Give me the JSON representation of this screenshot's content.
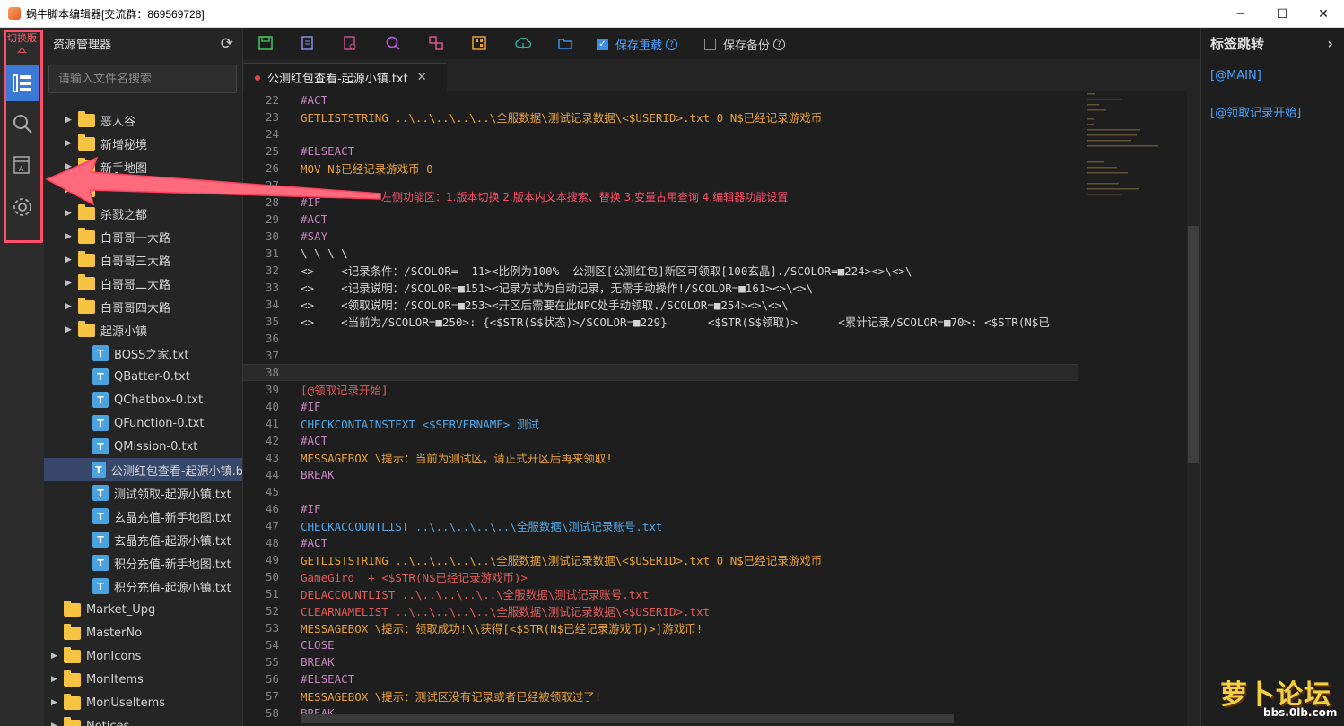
{
  "window": {
    "title": "蜗牛脚本编辑器[交流群：869569728]",
    "minimize": "─",
    "maximize": "☐",
    "close": "✕"
  },
  "activity": {
    "switch_version": "切换版本",
    "icons": [
      "explorer-icon",
      "search-icon",
      "variable-icon",
      "settings-icon"
    ]
  },
  "sidebar": {
    "title": "资源管理器",
    "search_placeholder": "请输入文件名搜索",
    "items": [
      {
        "type": "folder",
        "label": "恶人谷",
        "indent": 1
      },
      {
        "type": "folder",
        "label": "新增秘境",
        "indent": 1
      },
      {
        "type": "folder",
        "label": "新手地图",
        "indent": 1
      },
      {
        "type": "folder",
        "label": "",
        "indent": 1
      },
      {
        "type": "folder",
        "label": "杀戮之都",
        "indent": 1
      },
      {
        "type": "folder",
        "label": "白哥哥一大路",
        "indent": 1
      },
      {
        "type": "folder",
        "label": "白哥哥三大路",
        "indent": 1
      },
      {
        "type": "folder",
        "label": "白哥哥二大路",
        "indent": 1
      },
      {
        "type": "folder",
        "label": "白哥哥四大路",
        "indent": 1
      },
      {
        "type": "folder",
        "label": "起源小镇",
        "indent": 1
      },
      {
        "type": "file",
        "label": "BOSS之家.txt",
        "indent": 2
      },
      {
        "type": "file",
        "label": "QBatter-0.txt",
        "indent": 2
      },
      {
        "type": "file",
        "label": "QChatbox-0.txt",
        "indent": 2
      },
      {
        "type": "file",
        "label": "QFunction-0.txt",
        "indent": 2
      },
      {
        "type": "file",
        "label": "QMission-0.txt",
        "indent": 2
      },
      {
        "type": "file",
        "label": "公测红包查看-起源小镇.b",
        "indent": 2,
        "selected": true
      },
      {
        "type": "file",
        "label": "测试领取-起源小镇.txt",
        "indent": 2
      },
      {
        "type": "file",
        "label": "玄晶充值-新手地图.txt",
        "indent": 2
      },
      {
        "type": "file",
        "label": "玄晶充值-起源小镇.txt",
        "indent": 2
      },
      {
        "type": "file",
        "label": "积分充值-新手地图.txt",
        "indent": 2
      },
      {
        "type": "file",
        "label": "积分充值-起源小镇.txt",
        "indent": 2
      },
      {
        "type": "folder",
        "label": "Market_Upg",
        "indent": 0,
        "noarrow": true
      },
      {
        "type": "folder",
        "label": "MasterNo",
        "indent": 0,
        "noarrow": true
      },
      {
        "type": "folder",
        "label": "MonIcons",
        "indent": 0
      },
      {
        "type": "folder",
        "label": "MonItems",
        "indent": 0
      },
      {
        "type": "folder",
        "label": "MonUseItems",
        "indent": 0
      },
      {
        "type": "folder",
        "label": "Notices",
        "indent": 0
      }
    ]
  },
  "toolbar": {
    "save_reload": "保存重载",
    "save_backup": "保存备份"
  },
  "tab": {
    "label": "公测红包查看-起源小镇.txt",
    "close": "✕"
  },
  "editor": {
    "lines": [
      {
        "n": "22",
        "t": "#ACT",
        "c": "#c586c0"
      },
      {
        "n": "23",
        "t": "GETLISTSTRING ..\\..\\..\\..\\..\\全服数据\\测试记录数据\\<$USERID>.txt 0 N$已经记录游戏币",
        "c": "#e8a23a"
      },
      {
        "n": "24",
        "t": "",
        "c": "#ccc"
      },
      {
        "n": "25",
        "t": "#ELSEACT",
        "c": "#c586c0"
      },
      {
        "n": "26",
        "t": "MOV N$已经记录游戏币 0",
        "c": "#e8a23a"
      },
      {
        "n": "27",
        "t": "",
        "c": "#ccc"
      },
      {
        "n": "28",
        "t": "#IF",
        "c": "#c586c0"
      },
      {
        "n": "29",
        "t": "#ACT",
        "c": "#c586c0"
      },
      {
        "n": "30",
        "t": "#SAY",
        "c": "#c586c0"
      },
      {
        "n": "31",
        "t": "\\ \\ \\ \\",
        "c": "#d4d4d4"
      },
      {
        "n": "32",
        "t": "<>    <记录条件：/SCOLOR=  11><比例为100%  公测区[公测红包]新区可领取[100玄晶]./SCOLOR=■224><>\\<>\\",
        "c": "#d4d4d4"
      },
      {
        "n": "33",
        "t": "<>    <记录说明：/SCOLOR=■151><记录方式为自动记录，无需手动操作!/SCOLOR=■161><>\\<>\\",
        "c": "#d4d4d4"
      },
      {
        "n": "34",
        "t": "<>    <领取说明：/SCOLOR=■253><开区后需要在此NPC处手动领取./SCOLOR=■254><>\\<>\\",
        "c": "#d4d4d4"
      },
      {
        "n": "35",
        "t": "<>    <当前为/SCOLOR=■250>: {<$STR(S$状态)>/SCOLOR=■229}      <$STR(S$领取)>      <累计记录/SCOLOR=■70>: <$STR(N$已",
        "c": "#d4d4d4"
      },
      {
        "n": "36",
        "t": "",
        "c": "#ccc"
      },
      {
        "n": "37",
        "t": "",
        "c": "#ccc"
      },
      {
        "n": "38",
        "t": "",
        "c": "#ccc"
      },
      {
        "n": "39",
        "t": "[@领取记录开始]",
        "c": "#e55b5b"
      },
      {
        "n": "40",
        "t": "#IF",
        "c": "#c586c0"
      },
      {
        "n": "41",
        "t": "CHECKCONTAINSTEXT <$SERVERNAME> 测试",
        "c": "#4fa8e8"
      },
      {
        "n": "42",
        "t": "#ACT",
        "c": "#c586c0"
      },
      {
        "n": "43",
        "t": "MESSAGEBOX \\提示：当前为测试区，请正式开区后再来领取!",
        "c": "#e8a23a"
      },
      {
        "n": "44",
        "t": "BREAK",
        "c": "#c586c0"
      },
      {
        "n": "45",
        "t": "",
        "c": "#ccc"
      },
      {
        "n": "46",
        "t": "#IF",
        "c": "#c586c0"
      },
      {
        "n": "47",
        "t": "CHECKACCOUNTLIST ..\\..\\..\\..\\..\\全服数据\\测试记录账号.txt",
        "c": "#4fa8e8"
      },
      {
        "n": "48",
        "t": "#ACT",
        "c": "#c586c0"
      },
      {
        "n": "49",
        "t": "GETLISTSTRING ..\\..\\..\\..\\..\\全服数据\\测试记录数据\\<$USERID>.txt 0 N$已经记录游戏币",
        "c": "#e8a23a"
      },
      {
        "n": "50",
        "t": "GameGird  + <$STR(N$已经记录游戏币)>",
        "c": "#e55b5b"
      },
      {
        "n": "51",
        "t": "DELACCOUNTLIST ..\\..\\..\\..\\..\\全服数据\\测试记录账号.txt",
        "c": "#e55b5b"
      },
      {
        "n": "52",
        "t": "CLEARNAMELIST ..\\..\\..\\..\\..\\全服数据\\测试记录数据\\<$USERID>.txt",
        "c": "#e55b5b"
      },
      {
        "n": "53",
        "t": "MESSAGEBOX \\提示：领取成功!\\\\获得[<$STR(N$已经记录游戏币)>]游戏币!",
        "c": "#e8a23a"
      },
      {
        "n": "54",
        "t": "CLOSE",
        "c": "#c586c0"
      },
      {
        "n": "55",
        "t": "BREAK",
        "c": "#c586c0"
      },
      {
        "n": "56",
        "t": "#ELSEACT",
        "c": "#c586c0"
      },
      {
        "n": "57",
        "t": "MESSAGEBOX \\提示：测试区没有记录或者已经被领取过了!",
        "c": "#e8a23a"
      },
      {
        "n": "58",
        "t": "BREAK",
        "c": "#c586c0"
      }
    ],
    "current_line": "38"
  },
  "rightpanel": {
    "title": "标签跳转",
    "items": [
      "[@MAIN]",
      "[@领取记录开始]"
    ]
  },
  "annotation": "左侧功能区：1.版本切换 2.版本内文本搜索、替换 3.变量占用查询 4.编辑器功能设置",
  "watermark": {
    "logo": "萝卜论坛",
    "url": "bbs.0lb.com"
  },
  "colors": {
    "accent": "#3b79d6",
    "annotation": "#ff4f6a",
    "link": "#4da3ff"
  }
}
